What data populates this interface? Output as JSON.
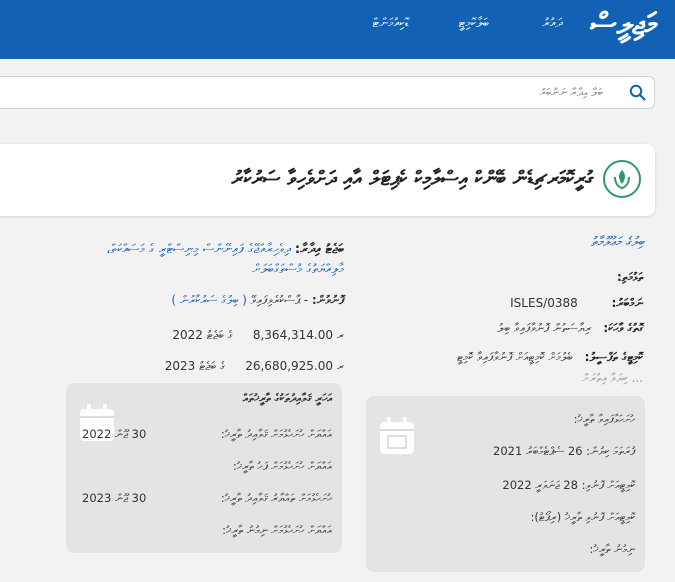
{
  "colors": {
    "primary": "#1261b5",
    "link": "#1a5fb4",
    "accent_green": "#2e9a6a",
    "panel": "#e4e4e4"
  },
  "header": {
    "brand": "މަޖިލީސް",
    "nav": [
      "ދައުރު",
      "ބަލާކޮމިޓީ",
      "ޑޮކިއުމަންޓް"
    ]
  },
  "search": {
    "placeholder": "ބަލާ އިދާރާ ނަންބަރު",
    "icon": "search-icon"
  },
  "title": {
    "icon": "emblem-icon",
    "text": "ގުރީކޮމަރޗިޑެން ބޭންކް އިސްލާމިކް ކެޕިޓަލް އާއި ދަށްވެހިވާ ސަރުކާރު"
  },
  "right_details": {
    "heading": "ބިލުގެ މަޢުލޫމާތު",
    "source_label": "ތަޅުމަތި:",
    "source_value": "",
    "ref_label": "ނަމްބަރު:",
    "ref_value": "ISLES/0388",
    "type_label": "ގޮތުގެ ވާހަކަ:",
    "type_value": "ރިޔާސަތުން ފޮނުވާފައިވާ ބިލު",
    "committee_label": "ކޮމިޓީގެ ތަފްސީލު:",
    "committee_value": "ބެލުމަށް ކޮމިޓީއަށް ފޮނުވާފައިވާ ކޮމިޓީ",
    "committee_more": "... ކިޔަވާ އިތުރަށް"
  },
  "left_details": {
    "link_label": "ބަޖެޓު އިދާރާ:",
    "link_value": "ދިވެހިރާއްޖޭގެ ފައިނޭންސް މިނިސްޓްރީ ގެ މަސައްކަތް،",
    "link_value2": "މާލިއްޔަތުގެ މުސްތަގްބަލަށް",
    "status_label": "ފޮނުވުން:",
    "status_prefix": "- ޕާސްކުރެވިފައިވޭ",
    "status_value": "( ބިލުގެ ސަރުކާރުން )",
    "amounts": [
      {
        "year": "2022",
        "label": "ގެ ބަޖެޓު",
        "value": "8,364,314.00 ރ"
      },
      {
        "year": "2023",
        "label": "ގެ ބަޖެޓު",
        "value": "26,680,925.00 ރ"
      }
    ]
  },
  "left_panel": {
    "title": "އަހަރީ ޤަވާއިދުތަކުގެ ތާރީޚުތައް",
    "lines": [
      "އައްޔަށް ހުށަހެޅުމަށް ޤަވާއިދު ތާރީޚު:",
      "30 ޖޫން 2022",
      "އައްޔަށް ހުށަހެޅުމަށް ފަހު ތާރީޚު:",
      "ހުށަހެޅުމަށް ތައްޔާރު ޤަވާއިދު ތާރީޚު:",
      "30 ޖޫން 2023",
      "އައްޔަށް ހުށަހެޅުމަށް ނިމުނު ތާރީޚު:"
    ]
  },
  "right_panel": {
    "lines": [
      "ހުށަހަޅާފައިވާ ތާރީޚު:",
      "ފުރަތަމަ ކިޔުން: 26 ސެޕްޓެމްބަރު 2021",
      "ކޮމިޓީއަށް ފޮނުވި: 28 ޖަނަވަރީ 2022",
      "ކޮމިޓީއަށް ފޮނުވި ތާރީޚު (ރިޕޯޓު):",
      "ނިމުނު ތާރީޚު:"
    ]
  }
}
